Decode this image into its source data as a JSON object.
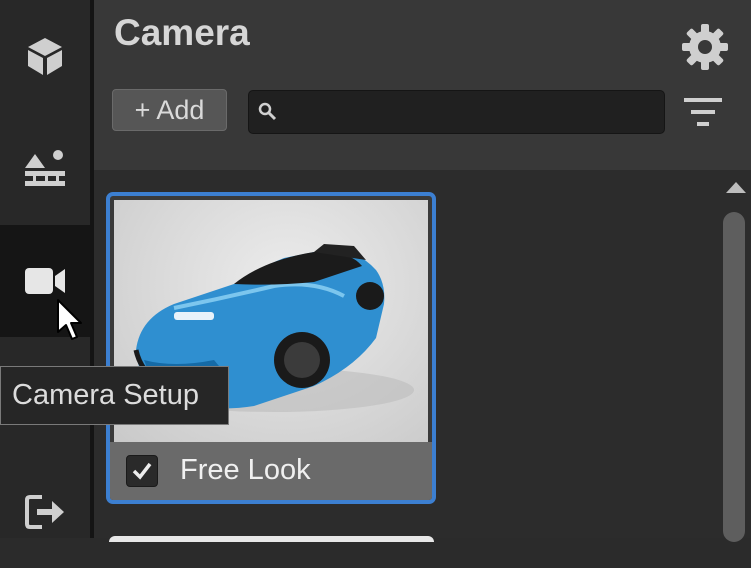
{
  "sidebar": {
    "items": [
      {
        "icon": "cube-icon"
      },
      {
        "icon": "terrain-icon"
      },
      {
        "icon": "video-camera-icon",
        "active": true
      },
      {
        "icon": "exit-icon"
      }
    ]
  },
  "header": {
    "title": "Camera",
    "settings_icon": "gear-icon",
    "add_label": "+ Add",
    "search_placeholder": "",
    "search_value": "",
    "filter_icon": "filter-icon"
  },
  "cards": [
    {
      "label": "Free Look",
      "checked": true,
      "selected": true
    }
  ],
  "tooltip": {
    "text": "Camera Setup"
  },
  "colors": {
    "accent": "#3c7fd1",
    "panel_bg": "#383838",
    "content_bg": "#2c2c2c"
  }
}
